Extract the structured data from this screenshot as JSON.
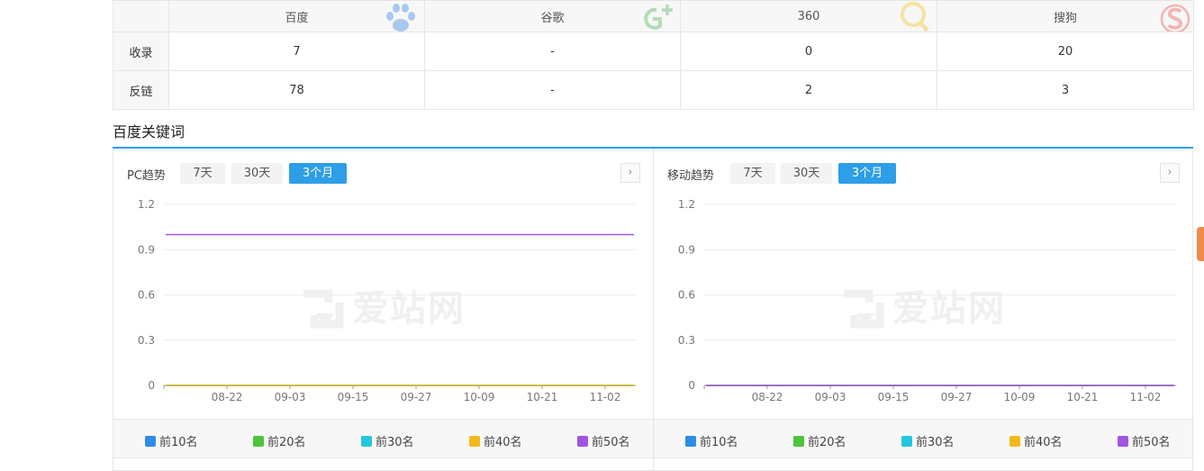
{
  "stats": {
    "engines": [
      {
        "name": "百度",
        "logo": "paw-icon",
        "color": "#a9c8ef"
      },
      {
        "name": "谷歌",
        "logo": "google-plus-icon",
        "color": "#b5dcb5"
      },
      {
        "name": "360",
        "logo": "magnifier-icon",
        "color": "#f6e2a0"
      },
      {
        "name": "搜狗",
        "logo": "sogou-icon",
        "color": "#f4b5b5"
      }
    ],
    "rows": [
      {
        "label": "收录",
        "values": [
          "7",
          "-",
          "0",
          "20"
        ]
      },
      {
        "label": "反链",
        "values": [
          "78",
          "-",
          "2",
          "3"
        ]
      }
    ]
  },
  "section": {
    "title": "百度关键词",
    "accent": "#2d9ee8"
  },
  "watermark": "爱站网",
  "ranges": [
    "7天",
    "30天",
    "3个月"
  ],
  "panels": [
    {
      "label": "PC趋势",
      "active_range": "3个月",
      "chart_data": {
        "type": "line",
        "x": [
          "08-22",
          "09-03",
          "09-15",
          "09-27",
          "10-09",
          "10-21",
          "11-02"
        ],
        "ylim": [
          0,
          1.2
        ],
        "yticks": [
          "1.2",
          "0.9",
          "0.6",
          "0.3",
          "0"
        ],
        "series": [
          {
            "name": "前10名",
            "color": "#2d8ce6",
            "value": 0
          },
          {
            "name": "前20名",
            "color": "#4cc43c",
            "value": 0
          },
          {
            "name": "前30名",
            "color": "#25c6e0",
            "value": 0
          },
          {
            "name": "前40名",
            "color": "#f3b81c",
            "value": 0
          },
          {
            "name": "前50名",
            "color": "#a255e0",
            "value": 1
          }
        ]
      }
    },
    {
      "label": "移动趋势",
      "active_range": "3个月",
      "chart_data": {
        "type": "line",
        "x": [
          "08-22",
          "09-03",
          "09-15",
          "09-27",
          "10-09",
          "10-21",
          "11-02"
        ],
        "ylim": [
          0,
          1.2
        ],
        "yticks": [
          "1.2",
          "0.9",
          "0.6",
          "0.3",
          "0"
        ],
        "series": [
          {
            "name": "前10名",
            "color": "#2d8ce6",
            "value": 0
          },
          {
            "name": "前20名",
            "color": "#4cc43c",
            "value": 0
          },
          {
            "name": "前30名",
            "color": "#25c6e0",
            "value": 0
          },
          {
            "name": "前40名",
            "color": "#f3b81c",
            "value": 0
          },
          {
            "name": "前50名",
            "color": "#a255e0",
            "value": 0
          }
        ]
      }
    }
  ]
}
